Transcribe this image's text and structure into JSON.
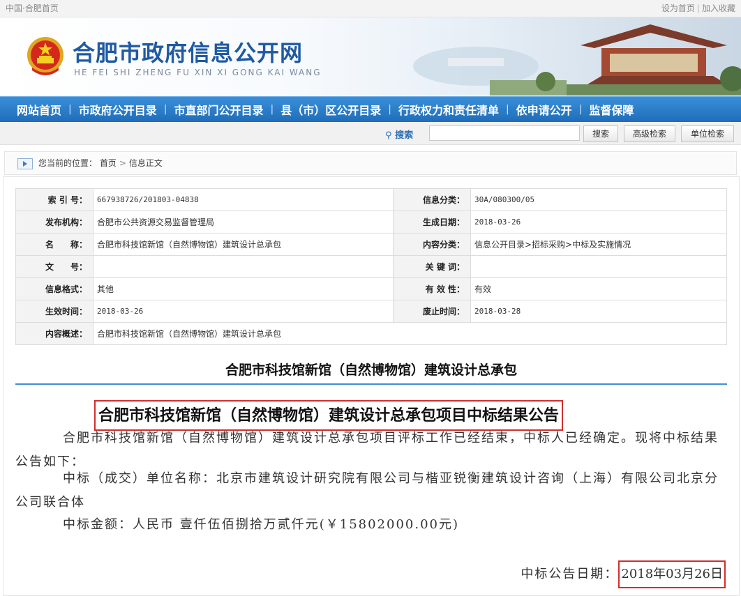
{
  "topbar": {
    "left_text": "中国·合肥首页",
    "set_home": "设为首页",
    "separator": "|",
    "add_favorite": "加入收藏"
  },
  "header": {
    "title": "合肥市政府信息公开网",
    "pinyin": "HE FEI SHI ZHENG FU XIN XI GONG KAI WANG"
  },
  "nav": {
    "items": [
      "网站首页",
      "市政府公开目录",
      "市直部门公开目录",
      "县（市）区公开目录",
      "行政权力和责任清单",
      "依申请公开",
      "监督保障"
    ],
    "separator": "|"
  },
  "search": {
    "label": "搜索",
    "input_value": "",
    "search_button": "搜索",
    "advanced_button": "高级检索",
    "unit_button": "单位检索"
  },
  "breadcrumb": {
    "prefix": "您当前的位置：",
    "home": "首页",
    "arrow": ">",
    "current": "信息正文"
  },
  "meta": {
    "index_label": "索 引 号：",
    "index_value": "667938726/201803-04838",
    "category_label": "信息分类：",
    "category_value": "30A/080300/05",
    "publisher_label": "发布机构：",
    "publisher_value": "合肥市公共资源交易监督管理局",
    "gen_date_label": "生成日期：",
    "gen_date_value": "2018-03-26",
    "name_label": "名　　称：",
    "name_value": "合肥市科技馆新馆（自然博物馆）建筑设计总承包",
    "content_cat_label": "内容分类：",
    "content_cat_value": "信息公开目录>招标采购>中标及实施情况",
    "doc_no_label": "文　　号：",
    "doc_no_value": "",
    "keywords_label": "关 键 词：",
    "keywords_value": "",
    "format_label": "信息格式：",
    "format_value": "其他",
    "validity_label": "有 效 性：",
    "validity_value": "有效",
    "effective_label": "生效时间：",
    "effective_value": "2018-03-26",
    "abolish_label": "废止时间：",
    "abolish_value": "2018-03-28",
    "summary_label": "内容概述：",
    "summary_value": "合肥市科技馆新馆（自然博物馆）建筑设计总承包"
  },
  "article": {
    "title": "合肥市科技馆新馆（自然博物馆）建筑设计总承包",
    "heading": "合肥市科技馆新馆（自然博物馆）建筑设计总承包项目中标结果公告",
    "para1": "合肥市科技馆新馆（自然博物馆）建筑设计总承包项目评标工作已经结束，中标人已经确定。现将中标结果公告如下：",
    "para2": "中标（成交）单位名称：北京市建筑设计研究院有限公司与楷亚锐衡建筑设计咨询（上海）有限公司北京分公司联合体",
    "para3": "中标金额：人民币 壹仟伍佰捌拾万贰仟元(￥15802000.00元)",
    "date_label": "中标公告日期：",
    "date_value": "2018年03月26日"
  },
  "colors": {
    "nav_blue": "#1f6dba",
    "title_blue": "#1f5aa3",
    "highlight_red": "#d32d2d"
  }
}
